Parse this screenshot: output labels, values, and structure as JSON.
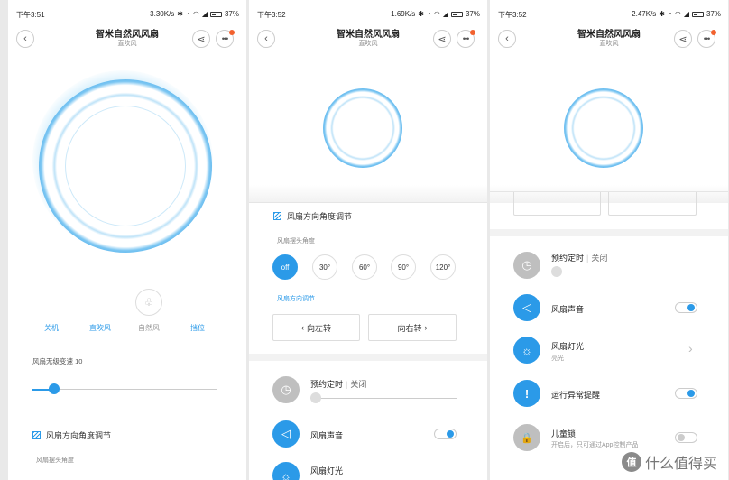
{
  "colors": {
    "accent": "#2b9ae8",
    "icon_gray": "#bbbbbb",
    "badge": "#f2612e"
  },
  "icons": {
    "back": "‹",
    "share": "⋖",
    "more": "•••",
    "power": "⏻",
    "wind": "≋",
    "leaf": "♧",
    "clock": "◷",
    "speaker": "◁",
    "light": "☼",
    "alert": "!",
    "lock": "🔒",
    "chevron": "›"
  },
  "screens": [
    {
      "status": {
        "time": "下午3:51",
        "speed": "3.30K/s",
        "battery": "37%"
      },
      "title": "智米自然风风扇",
      "subtitle": "直吹风",
      "modes": [
        {
          "label": "关机",
          "glyph": "⏻",
          "active": true
        },
        {
          "label": "直吹风",
          "glyph": "≋",
          "active": true
        },
        {
          "label": "自然风",
          "glyph": "♧",
          "active": false
        },
        {
          "label": "挡位",
          "glyph": "1",
          "active": true
        }
      ],
      "speed_label": "风扇无级变速 10",
      "speed_value": 10,
      "section_title": "风扇方向角度调节",
      "swing_label": "风扇摆头角度"
    },
    {
      "status": {
        "time": "下午3:52",
        "speed": "1.69K/s",
        "battery": "37%"
      },
      "title": "智米自然风风扇",
      "subtitle": "直吹风",
      "section_title": "风扇方向角度调节",
      "swing_label": "风扇摆头角度",
      "angles": [
        "off",
        "30°",
        "60°",
        "90°",
        "120°"
      ],
      "direction_label": "风扇方向调节",
      "turn_left": "向左转",
      "turn_right": "向右转",
      "timer_title": "预约定时",
      "timer_state": "关闭",
      "sound_title": "风扇声音",
      "sound_on": true,
      "light_title": "风扇灯光"
    },
    {
      "status": {
        "time": "下午3:52",
        "speed": "2.47K/s",
        "battery": "37%"
      },
      "title": "智米自然风风扇",
      "subtitle": "直吹风",
      "timer_title": "预约定时",
      "timer_state": "关闭",
      "sound_title": "风扇声音",
      "sound_on": true,
      "light_title": "风扇灯光",
      "light_sub": "亮光",
      "alert_title": "运行异常提醒",
      "alert_on": true,
      "lock_title": "儿童锁",
      "lock_sub": "开启后，只可通过App控制产品",
      "lock_on": false
    }
  ],
  "watermark": {
    "badge": "值",
    "text": "什么值得买"
  }
}
